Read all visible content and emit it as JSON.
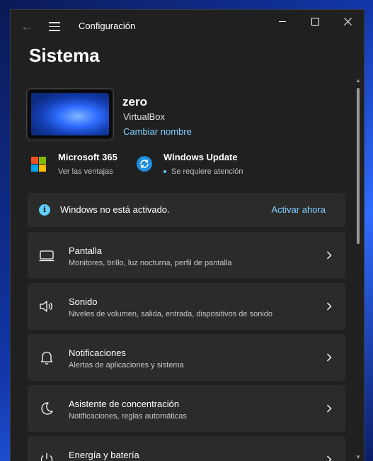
{
  "window": {
    "title": "Configuración"
  },
  "page": {
    "title": "Sistema"
  },
  "device": {
    "name": "zero",
    "model": "VirtualBox",
    "rename_link": "Cambiar nombre"
  },
  "quick_links": {
    "m365": {
      "title": "Microsoft 365",
      "subtitle": "Ver las ventajas"
    },
    "update": {
      "title": "Windows Update",
      "subtitle": "Se requiere atención"
    }
  },
  "activation": {
    "message": "Windows no está activado.",
    "action": "Activar ahora"
  },
  "cards": [
    {
      "icon": "monitor-icon",
      "title": "Pantalla",
      "subtitle": "Monitores, brillo, luz nocturna, perfil de pantalla"
    },
    {
      "icon": "speaker-icon",
      "title": "Sonido",
      "subtitle": "Niveles de volumen, salida, entrada, dispositivos de sonido"
    },
    {
      "icon": "bell-icon",
      "title": "Notificaciones",
      "subtitle": "Alertas de aplicaciones y sistema"
    },
    {
      "icon": "moon-icon",
      "title": "Asistente de concentración",
      "subtitle": "Notificaciones, reglas automáticas"
    },
    {
      "icon": "power-icon",
      "title": "Energía y batería",
      "subtitle": ""
    }
  ],
  "colors": {
    "window_bg": "#202020",
    "card_bg": "#2b2b2b",
    "accent_link": "#7fd0ff",
    "info_accent": "#60cdff",
    "update_icon": "#1e8fe0",
    "ms_red": "#f25022",
    "ms_green": "#7fba00",
    "ms_blue": "#00a4ef",
    "ms_yellow": "#ffb900"
  }
}
